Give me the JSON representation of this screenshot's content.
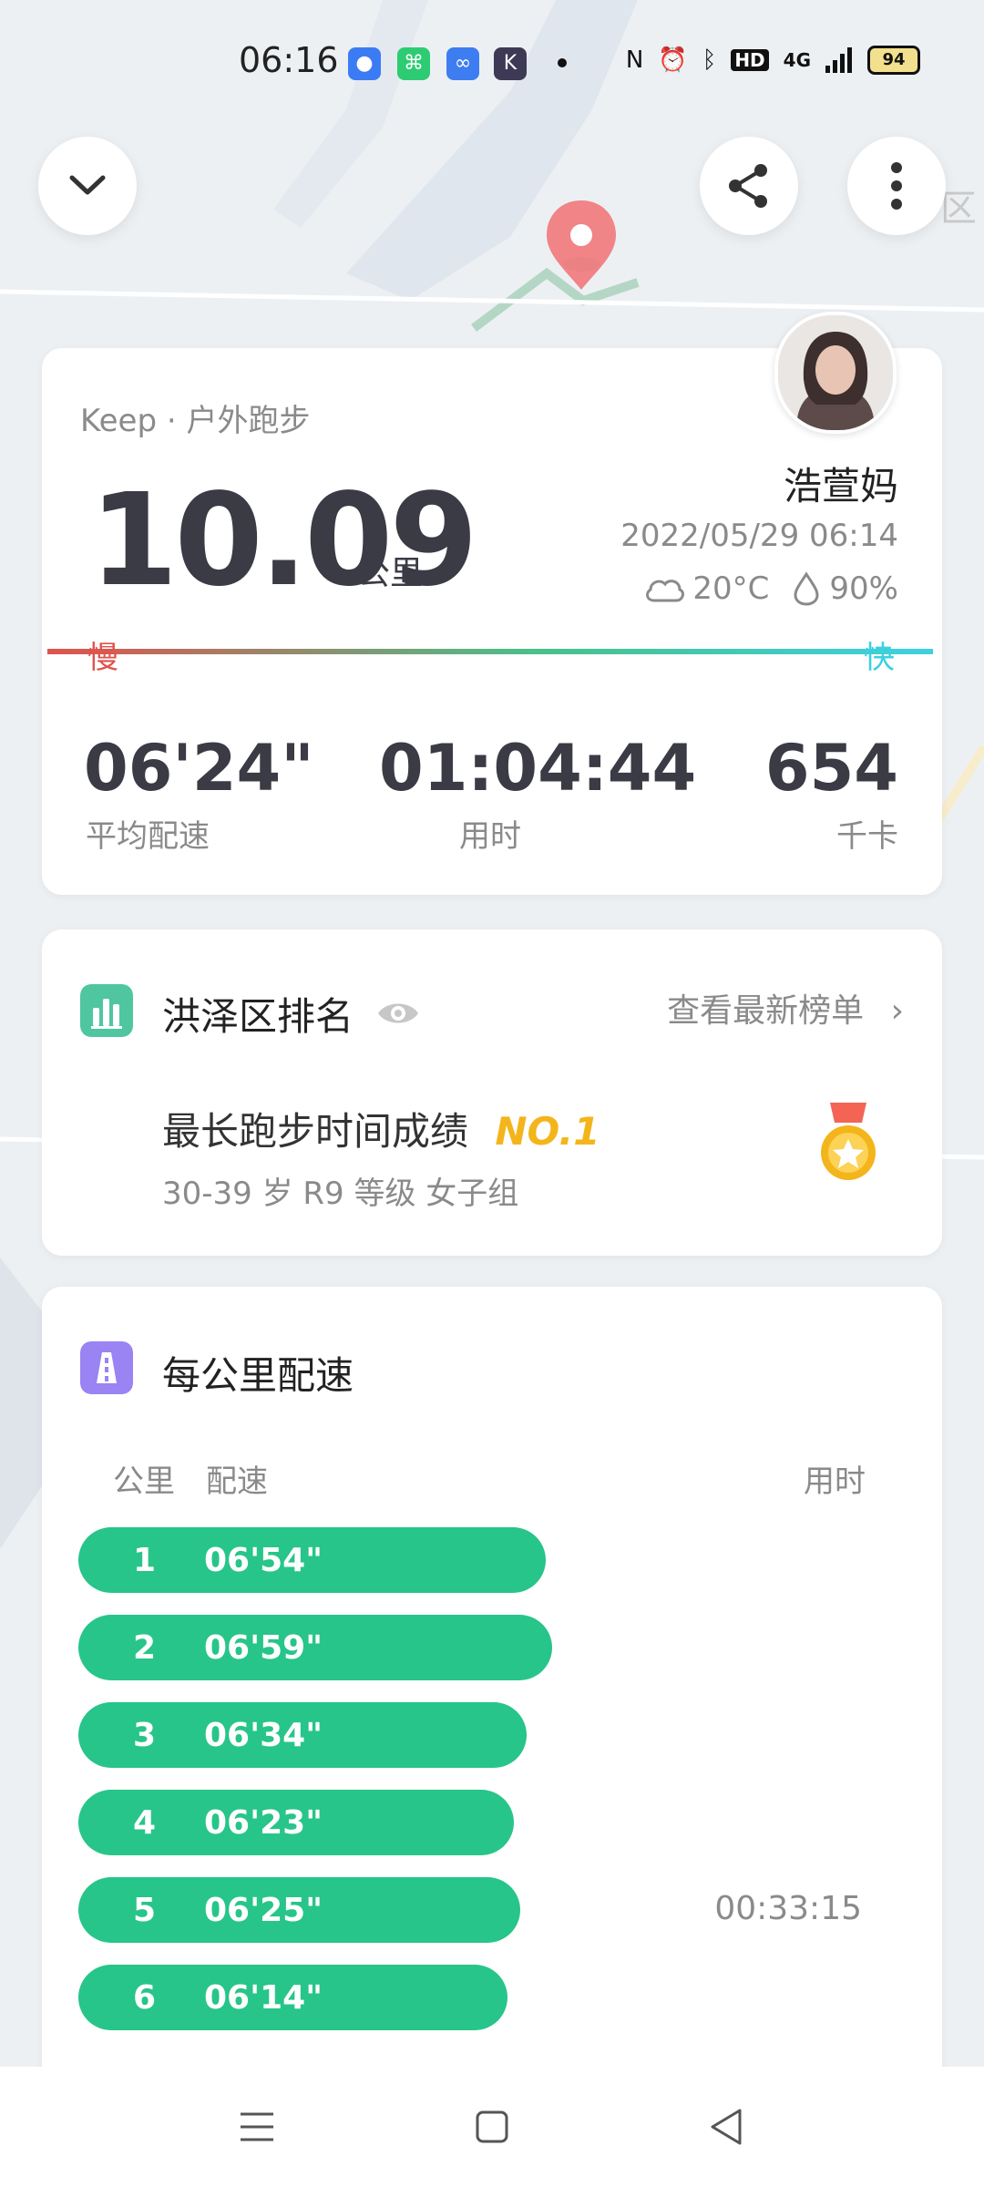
{
  "status_bar": {
    "time": "06:16",
    "network": "4G",
    "hd": "HD",
    "battery": "94",
    "app_icons": [
      "baidu-icon",
      "shopping-icon",
      "loop-icon",
      "k-icon"
    ]
  },
  "map": {
    "district_label": "区"
  },
  "header": {
    "collapse_icon": "chevron-down-icon",
    "share_icon": "share-icon",
    "more_icon": "more-vertical-icon"
  },
  "summary": {
    "source": "Keep · 户外跑步",
    "distance": "10.09",
    "distance_unit": "公里",
    "user_name": "浩萱妈",
    "datetime": "2022/05/29 06:14",
    "temperature": "20°C",
    "humidity": "90%",
    "slow_label": "慢",
    "fast_label": "快",
    "stats": [
      {
        "value": "06'24\"",
        "label": "平均配速"
      },
      {
        "value": "01:04:44",
        "label": "用时"
      },
      {
        "value": "654",
        "label": "千卡"
      }
    ]
  },
  "ranking": {
    "title": "洪泽区排名",
    "link": "查看最新榜单",
    "achievement": "最长跑步时间成绩",
    "rank": "NO.1",
    "group": "30-39 岁 R9 等级 女子组"
  },
  "splits": {
    "title": "每公里配速",
    "col_km": "公里",
    "col_pace": "配速",
    "col_time": "用时",
    "rows": [
      {
        "km": "1",
        "pace": "06'54\"",
        "fill": 0.73
      },
      {
        "km": "2",
        "pace": "06'59\"",
        "fill": 0.74
      },
      {
        "km": "3",
        "pace": "06'34\"",
        "fill": 0.7
      },
      {
        "km": "4",
        "pace": "06'23\"",
        "fill": 0.68
      },
      {
        "km": "5",
        "pace": "06'25\"",
        "fill": 0.69,
        "time": "00:33:15"
      },
      {
        "km": "6",
        "pace": "06'14\"",
        "fill": 0.67
      }
    ]
  },
  "nav": {
    "menu": "menu-icon",
    "home": "home-icon",
    "back": "back-icon"
  }
}
